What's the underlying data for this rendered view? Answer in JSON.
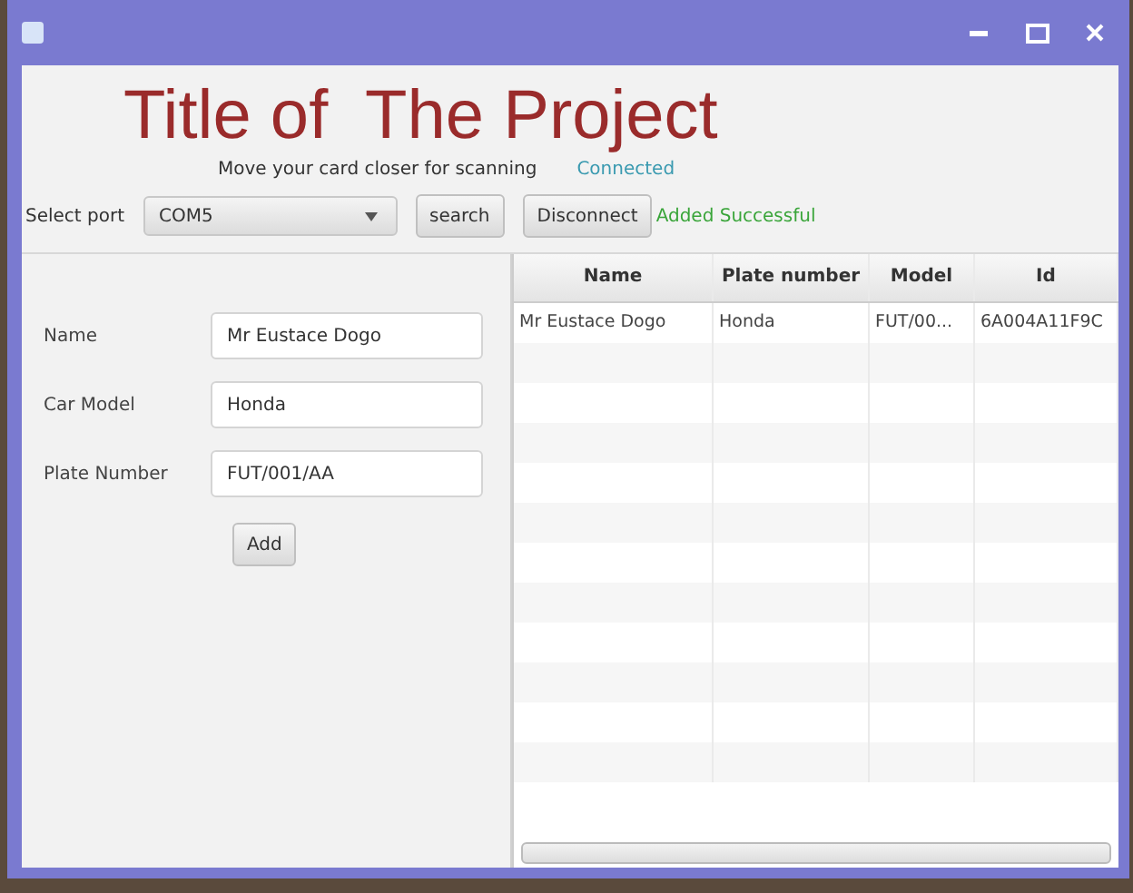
{
  "header": {
    "title": "Title of  The Project",
    "message": "Move your card closer for scanning",
    "connection": "Connected"
  },
  "toolbar": {
    "port_label": "Select port",
    "port": "COM5",
    "search_button": "search",
    "disconnect_button": "Disconnect",
    "result": "Added Successful"
  },
  "form": {
    "fields": [
      {
        "label": "Name",
        "value": "Mr Eustace Dogo"
      },
      {
        "label": "Car Model",
        "value": "Honda"
      },
      {
        "label": "Plate Number",
        "value": "FUT/001/AA"
      }
    ],
    "add_button": "Add"
  },
  "table": {
    "columns": [
      "Name",
      "Plate number",
      "Model",
      "Id"
    ],
    "rows": [
      [
        "Mr Eustace Dogo",
        "Honda",
        "FUT/00...",
        "6A004A11F9C"
      ]
    ]
  }
}
